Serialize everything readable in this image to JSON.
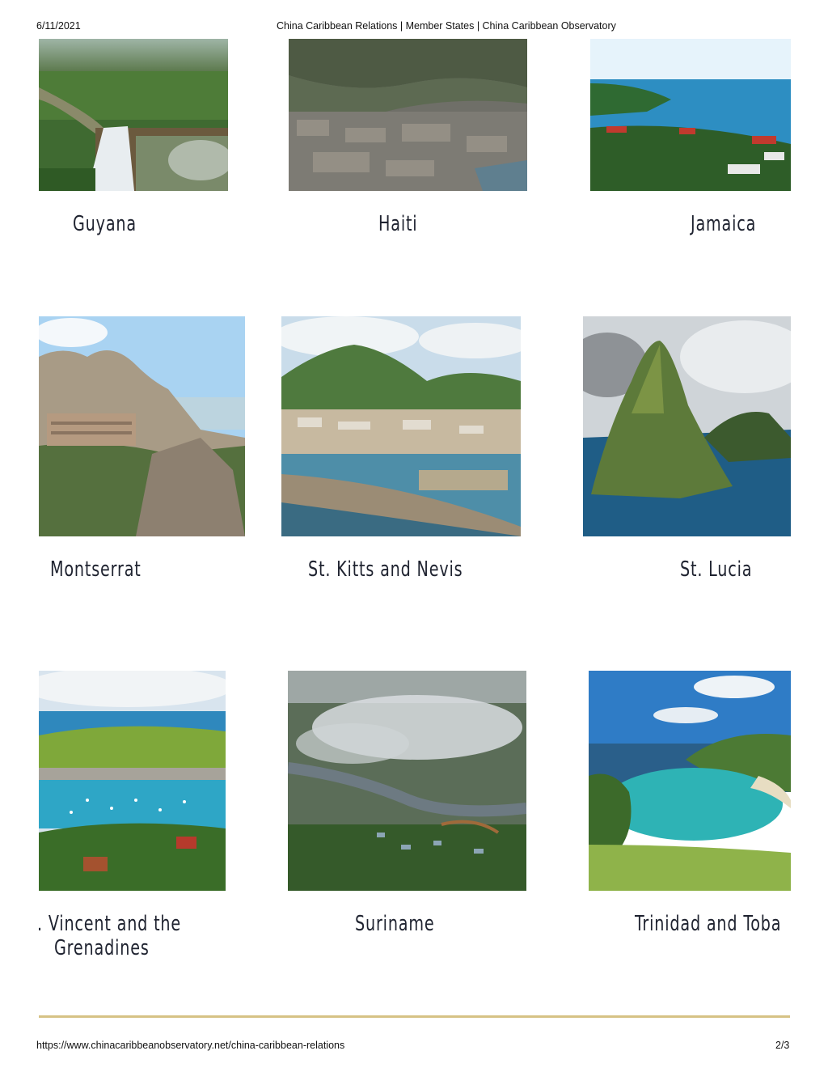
{
  "browser": {
    "date": "6/11/2021",
    "title": "China Caribbean Relations | Member States | China Caribbean Observatory",
    "url": "https://www.chinacaribbeanobservatory.net/china-caribbean-relations",
    "page": "2/3"
  },
  "colors": {
    "divider": "#d6c285",
    "caption": "#1f2330"
  },
  "states": [
    {
      "name": "Guyana",
      "image": "waterfall-jungle-photo"
    },
    {
      "name": "Haiti",
      "image": "city-aerial-photo"
    },
    {
      "name": "Jamaica",
      "image": "coastal-bay-photo"
    },
    {
      "name": "Montserrat",
      "image": "mountain-monastery-photo"
    },
    {
      "name": "St. Kitts and Nevis",
      "image": "harbor-town-photo"
    },
    {
      "name": "St. Lucia",
      "image": "piton-peak-photo"
    },
    {
      "name": "St. Vincent and the Grenadines",
      "line1": ". Vincent and the",
      "line2": "Grenadines",
      "image": "sailboat-bay-photo"
    },
    {
      "name": "Suriname",
      "image": "foggy-rainforest-photo"
    },
    {
      "name": "Trinidad and Tobago",
      "display": "Trinidad and Toba",
      "image": "tropical-cove-photo"
    }
  ]
}
